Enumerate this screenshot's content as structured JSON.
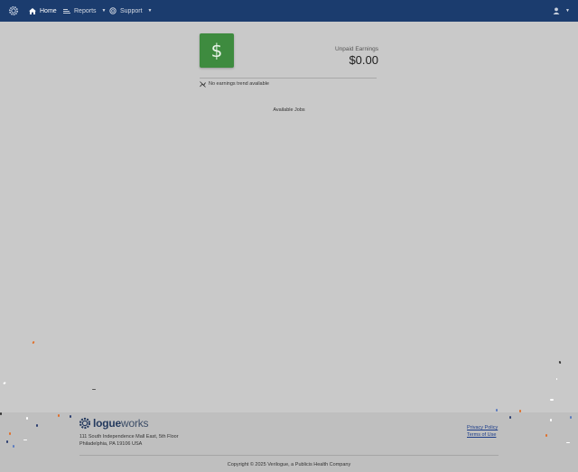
{
  "nav": {
    "home": "Home",
    "reports": "Reports",
    "support": "Support"
  },
  "earnings": {
    "label": "Unpaid Earnings",
    "value": "$0.00",
    "trend_text": "No earnings trend available"
  },
  "jobs": {
    "title": "Available Jobs"
  },
  "footer": {
    "logo_brand": "logue",
    "logo_suffix": "works",
    "address_line1": "111 South Independence Mall East, 5th Floor",
    "address_line2": "Philadelphia, PA 19106 USA",
    "privacy": "Privacy Policy",
    "terms": "Terms of Use",
    "copyright": "Copyright © 2025 Verilogue, a Publicis Health Company"
  },
  "colors": {
    "navbar": "#1b3c6e",
    "earnings_tile": "#3e8b3f",
    "link": "#1b3c8a"
  },
  "icons": {
    "app_logo": "gear-logo-icon",
    "home": "home-icon",
    "reports": "reports-icon",
    "support": "support-icon",
    "user": "user-icon",
    "earnings": "dollar-icon",
    "trend": "no-trend-icon"
  }
}
